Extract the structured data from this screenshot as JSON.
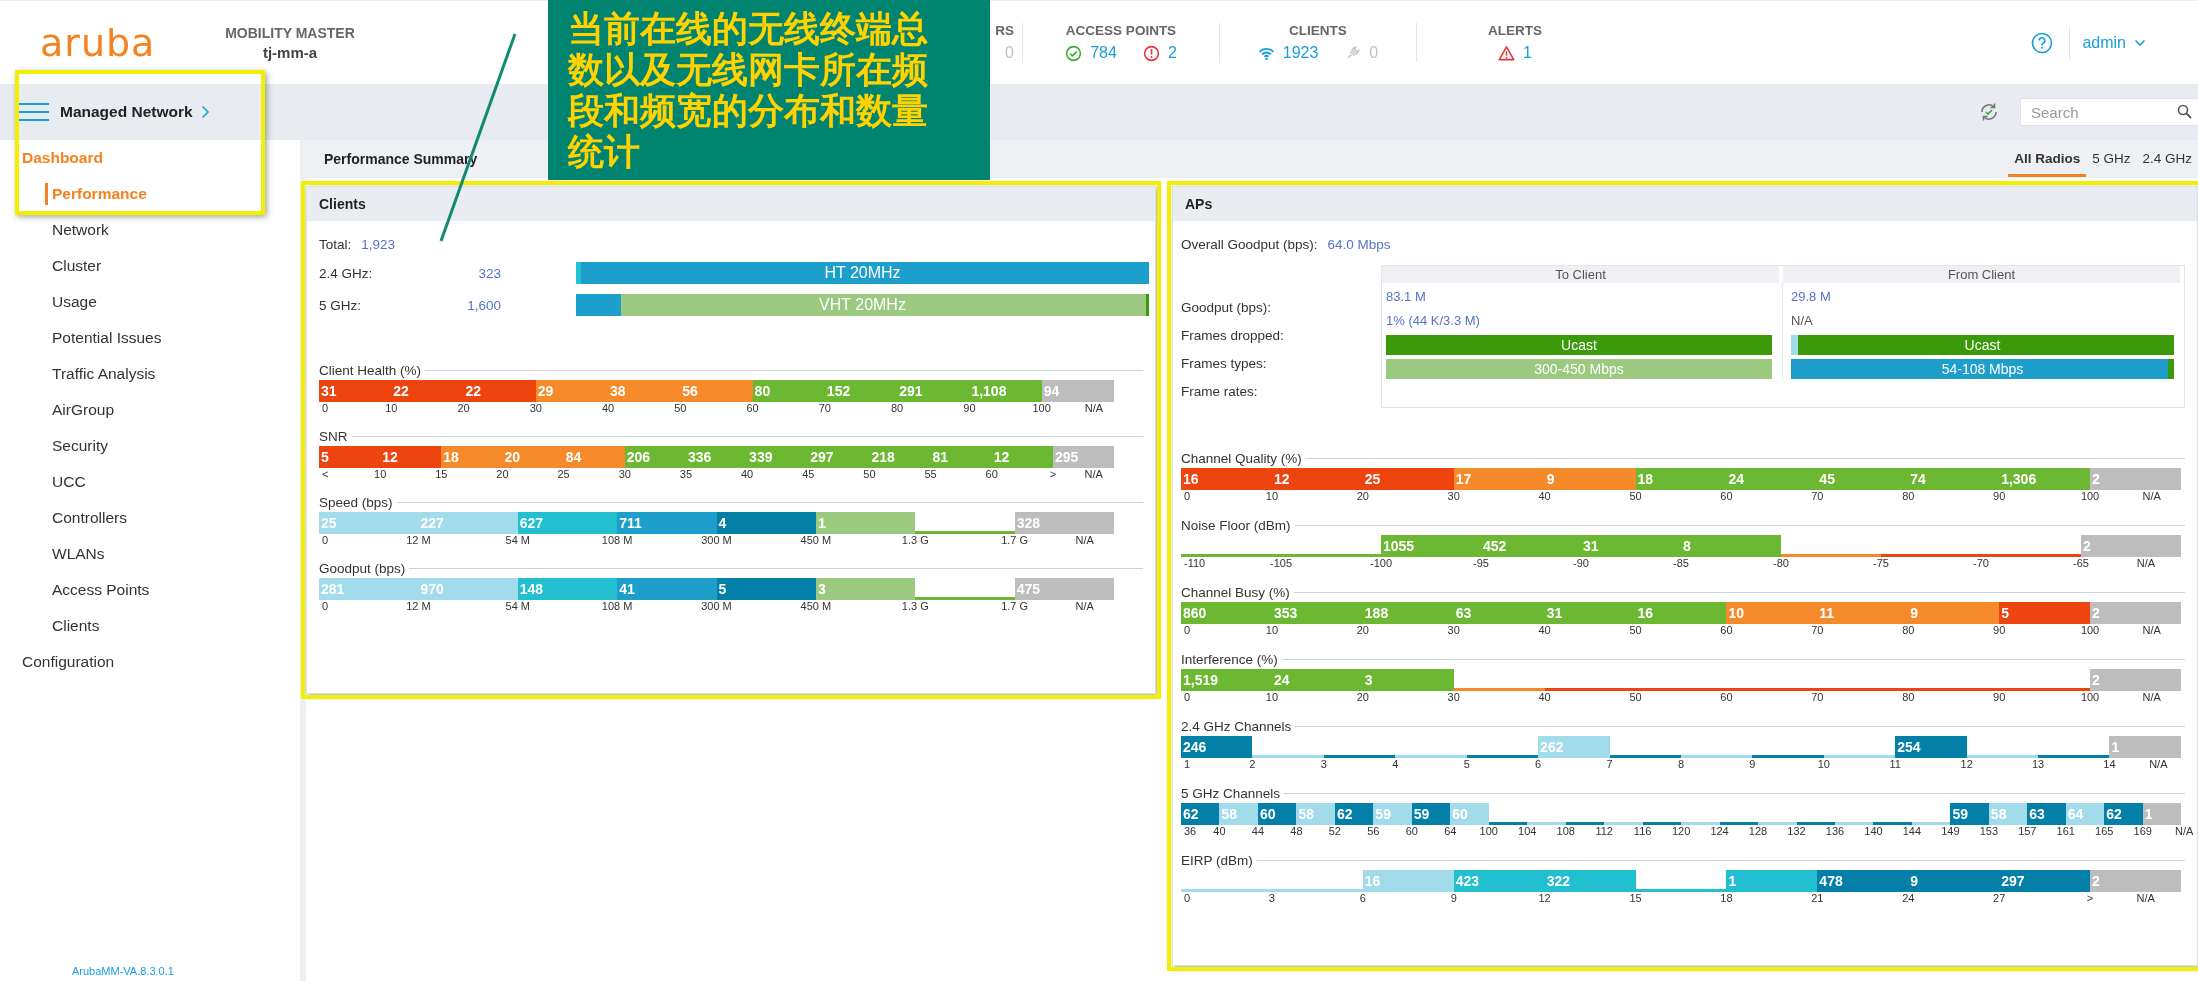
{
  "header": {
    "logo": "aruba",
    "product": "MOBILITY MASTER",
    "host": "tj-mm-a",
    "stats": [
      {
        "label": "RS",
        "values": [
          {
            "kind": "plain",
            "text": "0",
            "disabled": true
          }
        ]
      },
      {
        "label": "ACCESS POINTS",
        "values": [
          {
            "kind": "ok",
            "text": "784",
            "disabled": false
          },
          {
            "kind": "error",
            "text": "2",
            "disabled": false
          }
        ]
      },
      {
        "label": "CLIENTS",
        "values": [
          {
            "kind": "wireless",
            "text": "1923",
            "disabled": false
          },
          {
            "kind": "wired",
            "text": "0",
            "disabled": true
          }
        ]
      },
      {
        "label": "ALERTS",
        "values": [
          {
            "kind": "alert",
            "text": "1",
            "disabled": false
          }
        ]
      }
    ],
    "user": "admin"
  },
  "toolbar": {
    "title": "Managed Network",
    "search": {
      "placeholder": "Search"
    }
  },
  "sidebar": {
    "items": [
      {
        "label": "Dashboard",
        "expanded": true,
        "children": [
          {
            "label": "Performance",
            "selected": true
          },
          {
            "label": "Network",
            "selected": false
          },
          {
            "label": "Cluster",
            "selected": false
          },
          {
            "label": "Usage",
            "selected": false
          },
          {
            "label": "Potential Issues",
            "selected": false
          },
          {
            "label": "Traffic Analysis",
            "selected": false
          },
          {
            "label": "AirGroup",
            "selected": false
          },
          {
            "label": "Security",
            "selected": false
          },
          {
            "label": "UCC",
            "selected": false
          },
          {
            "label": "Controllers",
            "selected": false
          },
          {
            "label": "WLANs",
            "selected": false
          },
          {
            "label": "Access Points",
            "selected": false
          },
          {
            "label": "Clients",
            "selected": false
          }
        ]
      },
      {
        "label": "Configuration",
        "expanded": false
      }
    ],
    "version": "ArubaMM-VA.8.3.0.1"
  },
  "summary": {
    "title": "Performance Summary",
    "tabs": [
      {
        "label": "All Radios",
        "selected": true
      },
      {
        "label": "5 GHz",
        "selected": false
      },
      {
        "label": "2.4 GHz",
        "selected": false
      }
    ]
  },
  "clients": {
    "title": "Clients",
    "highlighted": true,
    "total_label": "Total:",
    "total": "1,923",
    "bands": [
      {
        "label": "2.4 GHz:",
        "count": "323",
        "bar": {
          "color": "#1d9fcc",
          "label": "HT 20MHz",
          "fill": {
            "color": "#22c4d4",
            "level": 0.008
          }
        }
      },
      {
        "label": "5 GHz:",
        "count": "1,600",
        "bar": {
          "color": "#9ac97f",
          "label": "VHT 20MHz",
          "fill": {
            "color": "#1d9fcc",
            "level": 0.079
          },
          "end_fill": {
            "color": "#3c9a0a",
            "level": 0.005
          }
        }
      }
    ],
    "histograms": [
      {
        "title": "Client Health (%)",
        "ticks": [
          "0",
          "10",
          "20",
          "30",
          "40",
          "50",
          "60",
          "70",
          "80",
          "90",
          "100",
          "N/A"
        ],
        "bins": [
          {
            "label": "31",
            "color": "#ee4410"
          },
          {
            "label": "22",
            "color": "#ee4410"
          },
          {
            "label": "22",
            "color": "#ee4410"
          },
          {
            "label": "29",
            "color": "#f58a2b"
          },
          {
            "label": "38",
            "color": "#f58a2b"
          },
          {
            "label": "56",
            "color": "#f58a2b"
          },
          {
            "label": "80",
            "color": "#6cb833"
          },
          {
            "label": "152",
            "color": "#6cb833"
          },
          {
            "label": "291",
            "color": "#6cb833"
          },
          {
            "label": "1,108",
            "color": "#6cb833"
          },
          {
            "label": "94",
            "color": "#bdbdbd"
          }
        ]
      },
      {
        "title": "SNR",
        "ticks": [
          "<",
          "10",
          "15",
          "20",
          "25",
          "30",
          "35",
          "40",
          "45",
          "50",
          "55",
          "60",
          ">",
          "N/A"
        ],
        "bins": [
          {
            "label": "5",
            "color": "#ee4410"
          },
          {
            "label": "12",
            "color": "#ee4410"
          },
          {
            "label": "18",
            "color": "#f58a2b"
          },
          {
            "label": "20",
            "color": "#f58a2b"
          },
          {
            "label": "84",
            "color": "#f58a2b"
          },
          {
            "label": "206",
            "color": "#6cb833"
          },
          {
            "label": "336",
            "color": "#6cb833"
          },
          {
            "label": "339",
            "color": "#6cb833"
          },
          {
            "label": "297",
            "color": "#6cb833"
          },
          {
            "label": "218",
            "color": "#6cb833"
          },
          {
            "label": "81",
            "color": "#6cb833"
          },
          {
            "label": "12",
            "color": "#6cb833"
          },
          {
            "label": "295",
            "color": "#bdbdbd"
          }
        ]
      },
      {
        "title": "Speed (bps)",
        "ticks": [
          "0",
          "12 M",
          "54 M",
          "108 M",
          "300 M",
          "450 M",
          "1.3 G",
          "1.7 G",
          "N/A"
        ],
        "bins": [
          {
            "label": "25",
            "color": "#a2dbea"
          },
          {
            "label": "227",
            "color": "#a2dbea"
          },
          {
            "label": "627",
            "color": "#22bfd1"
          },
          {
            "label": "711",
            "color": "#1e9ecb"
          },
          {
            "label": "4",
            "color": "#0480a8"
          },
          {
            "label": "1",
            "color": "#9ac97f"
          },
          {
            "color": "#6cb833"
          },
          {
            "label": "328",
            "color": "#bdbdbd"
          }
        ]
      },
      {
        "title": "Goodput (bps)",
        "ticks": [
          "0",
          "12 M",
          "54 M",
          "108 M",
          "300 M",
          "450 M",
          "1.3 G",
          "1.7 G",
          "N/A"
        ],
        "bins": [
          {
            "label": "281",
            "color": "#a2dbea"
          },
          {
            "label": "970",
            "color": "#a2dbea"
          },
          {
            "label": "148",
            "color": "#22bfd1"
          },
          {
            "label": "41",
            "color": "#1e9ecb"
          },
          {
            "label": "5",
            "color": "#0480a8"
          },
          {
            "label": "3",
            "color": "#9ac97f"
          },
          {
            "color": "#6cb833"
          },
          {
            "label": "475",
            "color": "#bdbdbd"
          }
        ]
      }
    ]
  },
  "aps": {
    "title": "APs",
    "highlighted": true,
    "overall_label": "Overall Goodput (bps):",
    "overall": "64.0 Mbps",
    "table": {
      "columns": [
        "To Client",
        "From Client"
      ],
      "rows": [
        {
          "label": "Goodput (bps):",
          "kind": "text",
          "cells": [
            {
              "text": "83.1 M",
              "muted": false
            },
            {
              "text": "29.8 M",
              "muted": false
            }
          ]
        },
        {
          "label": "Frames dropped:",
          "kind": "text",
          "cells": [
            {
              "text": "1% (44 K/3.3 M)",
              "muted": false
            },
            {
              "text": "N/A",
              "muted": true
            }
          ]
        },
        {
          "label": "Frames types:",
          "kind": "bar",
          "cells": [
            {
              "bar": {
                "color": "#3c9a0a",
                "label": "Ucast"
              }
            },
            {
              "bar": {
                "color": "#3c9a0a",
                "label": "Ucast",
                "fill": {
                  "color": "#a2dbea",
                  "level": 0.018
                }
              }
            }
          ]
        },
        {
          "label": "Frame rates:",
          "kind": "bar",
          "cells": [
            {
              "bar": {
                "color": "#9ac97f",
                "label": "300-450 Mbps"
              }
            },
            {
              "bar": {
                "color": "#1e9ecb",
                "label": "54-108 Mbps",
                "end_fill": {
                  "color": "#3c9a0a",
                  "level": 0.015
                }
              }
            }
          ]
        }
      ]
    },
    "histograms": [
      {
        "title": "Channel Quality (%)",
        "ticks": [
          "0",
          "10",
          "20",
          "30",
          "40",
          "50",
          "60",
          "70",
          "80",
          "90",
          "100",
          "N/A"
        ],
        "bins": [
          {
            "label": "16",
            "color": "#ee4410"
          },
          {
            "label": "12",
            "color": "#ee4410"
          },
          {
            "label": "25",
            "color": "#ee4410"
          },
          {
            "label": "17",
            "color": "#f58a2b"
          },
          {
            "label": "9",
            "color": "#f58a2b"
          },
          {
            "label": "18",
            "color": "#6cb833"
          },
          {
            "label": "24",
            "color": "#6cb833"
          },
          {
            "label": "45",
            "color": "#6cb833"
          },
          {
            "label": "74",
            "color": "#6cb833"
          },
          {
            "label": "1,306",
            "color": "#6cb833"
          },
          {
            "label": "2",
            "color": "#bdbdbd"
          }
        ]
      },
      {
        "title": "Noise Floor (dBm)",
        "ticks": [
          "-110",
          "-105",
          "-100",
          "-95",
          "-90",
          "-85",
          "-80",
          "-75",
          "-70",
          "-65",
          "N/A"
        ],
        "bins": [
          {
            "color": "#6cb833"
          },
          {
            "color": "#6cb833"
          },
          {
            "label": "1055",
            "color": "#6cb833"
          },
          {
            "label": "452",
            "color": "#6cb833"
          },
          {
            "label": "31",
            "color": "#6cb833"
          },
          {
            "label": "8",
            "color": "#6cb833"
          },
          {
            "color": "#f58a2b"
          },
          {
            "color": "#ee4410"
          },
          {
            "color": "#ee4410"
          },
          {
            "label": "2",
            "color": "#bdbdbd"
          }
        ]
      },
      {
        "title": "Channel Busy (%)",
        "ticks": [
          "0",
          "10",
          "20",
          "30",
          "40",
          "50",
          "60",
          "70",
          "80",
          "90",
          "100",
          "N/A"
        ],
        "bins": [
          {
            "label": "860",
            "color": "#6cb833"
          },
          {
            "label": "353",
            "color": "#6cb833"
          },
          {
            "label": "188",
            "color": "#6cb833"
          },
          {
            "label": "63",
            "color": "#6cb833"
          },
          {
            "label": "31",
            "color": "#6cb833"
          },
          {
            "label": "16",
            "color": "#6cb833"
          },
          {
            "label": "10",
            "color": "#f58a2b"
          },
          {
            "label": "11",
            "color": "#f58a2b"
          },
          {
            "label": "9",
            "color": "#f58a2b"
          },
          {
            "label": "5",
            "color": "#ee4410"
          },
          {
            "label": "2",
            "color": "#bdbdbd"
          }
        ]
      },
      {
        "title": "Interference (%)",
        "ticks": [
          "0",
          "10",
          "20",
          "30",
          "40",
          "50",
          "60",
          "70",
          "80",
          "90",
          "100",
          "N/A"
        ],
        "bins": [
          {
            "label": "1,519",
            "color": "#6cb833"
          },
          {
            "label": "24",
            "color": "#6cb833"
          },
          {
            "label": "3",
            "color": "#6cb833"
          },
          {
            "color": "#f58a2b"
          },
          {
            "color": "#ee4410"
          },
          {
            "color": "#ee4410"
          },
          {
            "color": "#ee4410"
          },
          {
            "color": "#ee4410"
          },
          {
            "color": "#ee4410"
          },
          {
            "color": "#ee4410"
          },
          {
            "label": "2",
            "color": "#bdbdbd"
          }
        ]
      },
      {
        "title": "2.4 GHz Channels",
        "ticks": [
          "1",
          "2",
          "3",
          "4",
          "5",
          "6",
          "7",
          "8",
          "9",
          "10",
          "11",
          "12",
          "13",
          "14",
          "N/A"
        ],
        "bins": [
          {
            "label": "246",
            "color": "#0480a8"
          },
          {
            "color": "#a2dbea"
          },
          {
            "color": "#0480a8"
          },
          {
            "color": "#a2dbea"
          },
          {
            "color": "#0480a8"
          },
          {
            "label": "262",
            "color": "#a2dbea"
          },
          {
            "color": "#0480a8"
          },
          {
            "color": "#a2dbea"
          },
          {
            "color": "#0480a8"
          },
          {
            "color": "#a2dbea"
          },
          {
            "label": "254",
            "color": "#0480a8"
          },
          {
            "color": "#a2dbea"
          },
          {
            "color": "#0480a8"
          },
          {
            "label": "1",
            "color": "#bdbdbd"
          }
        ]
      },
      {
        "title": "5 GHz Channels",
        "ticks": [
          "36",
          "40",
          "44",
          "48",
          "52",
          "56",
          "60",
          "64",
          "100",
          "104",
          "108",
          "112",
          "116",
          "120",
          "124",
          "128",
          "132",
          "136",
          "140",
          "144",
          "149",
          "153",
          "157",
          "161",
          "165",
          "169",
          "N/A"
        ],
        "bins": [
          {
            "label": "62",
            "color": "#0480a8"
          },
          {
            "label": "58",
            "color": "#a2dbea"
          },
          {
            "label": "60",
            "color": "#0480a8"
          },
          {
            "label": "58",
            "color": "#a2dbea"
          },
          {
            "label": "62",
            "color": "#0480a8"
          },
          {
            "label": "59",
            "color": "#a2dbea"
          },
          {
            "label": "59",
            "color": "#0480a8"
          },
          {
            "label": "60",
            "color": "#a2dbea"
          },
          {
            "color": "#0480a8"
          },
          {
            "color": "#a2dbea"
          },
          {
            "color": "#0480a8"
          },
          {
            "color": "#a2dbea"
          },
          {
            "color": "#0480a8"
          },
          {
            "color": "#a2dbea"
          },
          {
            "color": "#0480a8"
          },
          {
            "color": "#a2dbea"
          },
          {
            "color": "#0480a8"
          },
          {
            "color": "#a2dbea"
          },
          {
            "color": "#0480a8"
          },
          {
            "color": "#a2dbea"
          },
          {
            "label": "59",
            "color": "#0480a8"
          },
          {
            "label": "58",
            "color": "#a2dbea"
          },
          {
            "label": "63",
            "color": "#0480a8"
          },
          {
            "label": "64",
            "color": "#a2dbea"
          },
          {
            "label": "62",
            "color": "#0480a8"
          },
          {
            "label": "1",
            "color": "#bdbdbd"
          }
        ]
      },
      {
        "title": "EIRP (dBm)",
        "ticks": [
          "0",
          "3",
          "6",
          "9",
          "12",
          "15",
          "18",
          "21",
          "24",
          "27",
          ">",
          "N/A"
        ],
        "bins": [
          {
            "color": "#a2dbea"
          },
          {
            "color": "#a2dbea"
          },
          {
            "label": "16",
            "color": "#a2dbea"
          },
          {
            "label": "423",
            "color": "#22bfd1"
          },
          {
            "label": "322",
            "color": "#22bfd1"
          },
          {
            "color": "#22bfd1"
          },
          {
            "label": "1",
            "color": "#22bfd1"
          },
          {
            "label": "478",
            "color": "#0480a8"
          },
          {
            "label": "9",
            "color": "#0480a8"
          },
          {
            "label": "297",
            "color": "#0480a8"
          },
          {
            "label": "2",
            "color": "#bdbdbd"
          }
        ]
      }
    ]
  },
  "annotation": {
    "text": "当前在线的无线终端总数以及无线网卡所在频段和频宽的分布和数量统计"
  }
}
